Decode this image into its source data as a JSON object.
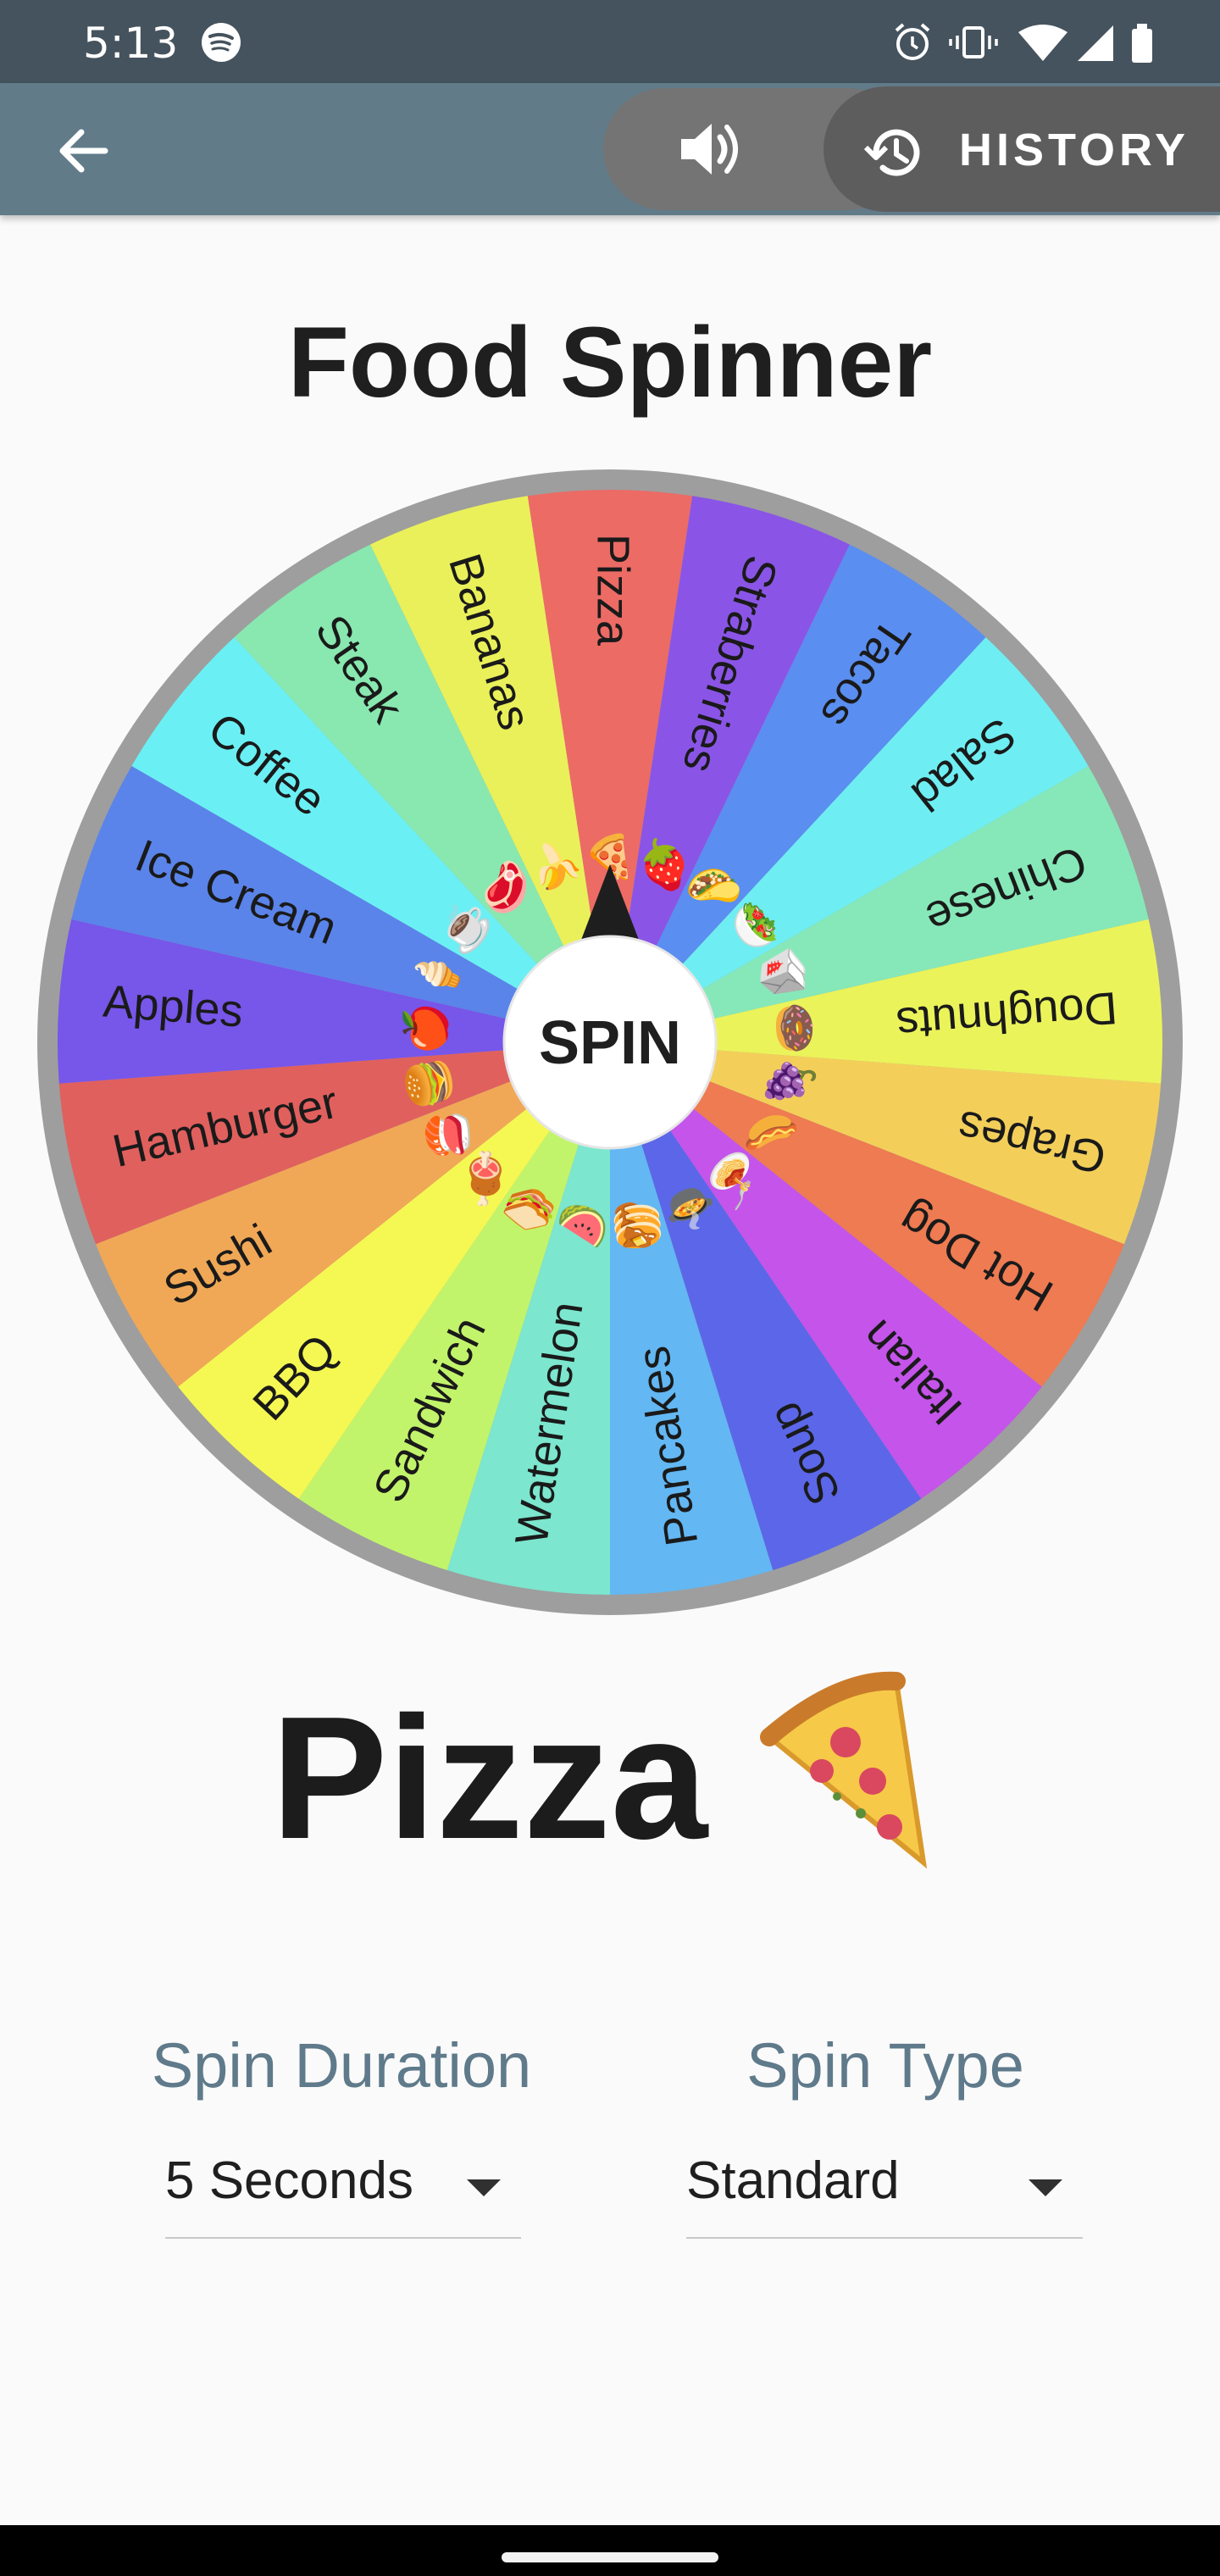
{
  "status_bar": {
    "time": "5:13",
    "icons": [
      "spotify-icon",
      "alarm-icon",
      "vibrate-icon",
      "wifi-icon",
      "signal-icon",
      "battery-icon"
    ]
  },
  "app_bar": {
    "back_icon": "arrow-left-icon",
    "sound_icon": "volume-icon",
    "history_label": "HISTORY",
    "history_icon": "history-icon"
  },
  "title": "Food Spinner",
  "wheel": {
    "center_label": "SPIN",
    "segments": [
      {
        "label": "Pizza",
        "emoji": "🍕",
        "color": "#ec6b65"
      },
      {
        "label": "Straberries",
        "emoji": "🍓",
        "color": "#8a55e6"
      },
      {
        "label": "Tacos",
        "emoji": "🌮",
        "color": "#5a8ef0"
      },
      {
        "label": "Salad",
        "emoji": "🥗",
        "color": "#6eeef2"
      },
      {
        "label": "Chinese",
        "emoji": "🥡",
        "color": "#86e8b8"
      },
      {
        "label": "Doughnuts",
        "emoji": "🍩",
        "color": "#ebf35a"
      },
      {
        "label": "Grapes",
        "emoji": "🍇",
        "color": "#f3cf5a"
      },
      {
        "label": "Hot Dog",
        "emoji": "🌭",
        "color": "#ee7b52"
      },
      {
        "label": "Italian",
        "emoji": "🍝",
        "color": "#c454ea"
      },
      {
        "label": "Soup",
        "emoji": "🍲",
        "color": "#5b67e8"
      },
      {
        "label": "Pancakes",
        "emoji": "🥞",
        "color": "#63b7f2"
      },
      {
        "label": "Watermelon",
        "emoji": "🍉",
        "color": "#7ce6ce"
      },
      {
        "label": "Sandwich",
        "emoji": "🥪",
        "color": "#c2f46b"
      },
      {
        "label": "BBQ",
        "emoji": "🍖",
        "color": "#f5f852"
      },
      {
        "label": "Sushi",
        "emoji": "🍣",
        "color": "#f0a856"
      },
      {
        "label": "Hamburger",
        "emoji": "🍔",
        "color": "#e0605e"
      },
      {
        "label": "Apples",
        "emoji": "🍎",
        "color": "#7756ea"
      },
      {
        "label": "Ice Cream",
        "emoji": "🍦",
        "color": "#5a84ea"
      },
      {
        "label": "Coffee",
        "emoji": "☕",
        "color": "#6af0f4"
      },
      {
        "label": "Steak",
        "emoji": "🥩",
        "color": "#88e8b0"
      },
      {
        "label": "Bananas",
        "emoji": "🍌",
        "color": "#eaf05a"
      }
    ],
    "rim_color": "#9e9e9e"
  },
  "result": {
    "label": "Pizza",
    "icon": "pizza-icon"
  },
  "settings": {
    "duration_label": "Spin Duration",
    "duration_value": "5 Seconds",
    "type_label": "Spin Type",
    "type_value": "Standard"
  },
  "colors": {
    "status_bar": "#45535e",
    "app_bar": "#617b89",
    "accent_label": "#5f7a8a"
  }
}
